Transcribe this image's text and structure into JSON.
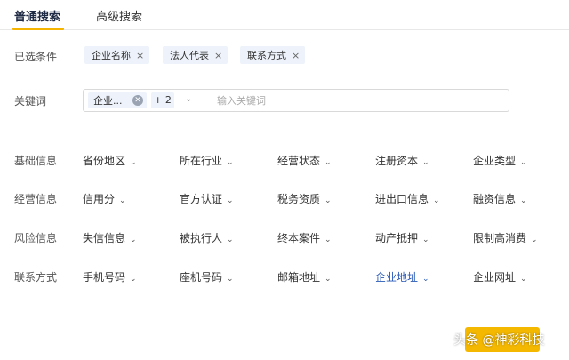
{
  "tabs": [
    {
      "label": "普通搜索",
      "active": true
    },
    {
      "label": "高级搜索",
      "active": false
    }
  ],
  "selected_conditions": {
    "label": "已选条件",
    "chips": [
      "企业名称",
      "法人代表",
      "联系方式"
    ]
  },
  "keyword": {
    "label": "关键词",
    "tag": "企业...",
    "more_count": "+ 2",
    "placeholder": "输入关键词"
  },
  "filter_groups": [
    {
      "label": "基础信息",
      "items": [
        "省份地区",
        "所在行业",
        "经营状态",
        "注册资本",
        "企业类型"
      ]
    },
    {
      "label": "经营信息",
      "items": [
        "信用分",
        "官方认证",
        "税务资质",
        "进出口信息",
        "融资信息"
      ]
    },
    {
      "label": "风险信息",
      "items": [
        "失信信息",
        "被执行人",
        "终本案件",
        "动产抵押",
        "限制高消费"
      ]
    },
    {
      "label": "联系方式",
      "items": [
        "手机号码",
        "座机号码",
        "邮箱地址",
        "企业地址",
        "企业网址"
      ]
    }
  ],
  "icons": {
    "chip_close": "×",
    "chevron": "⌄"
  },
  "colors": {
    "accent": "#f5b400",
    "highlight_text": "#2a5ab8",
    "chip_bg": "#eef3fb"
  },
  "watermark": "头条 @神彩科技"
}
